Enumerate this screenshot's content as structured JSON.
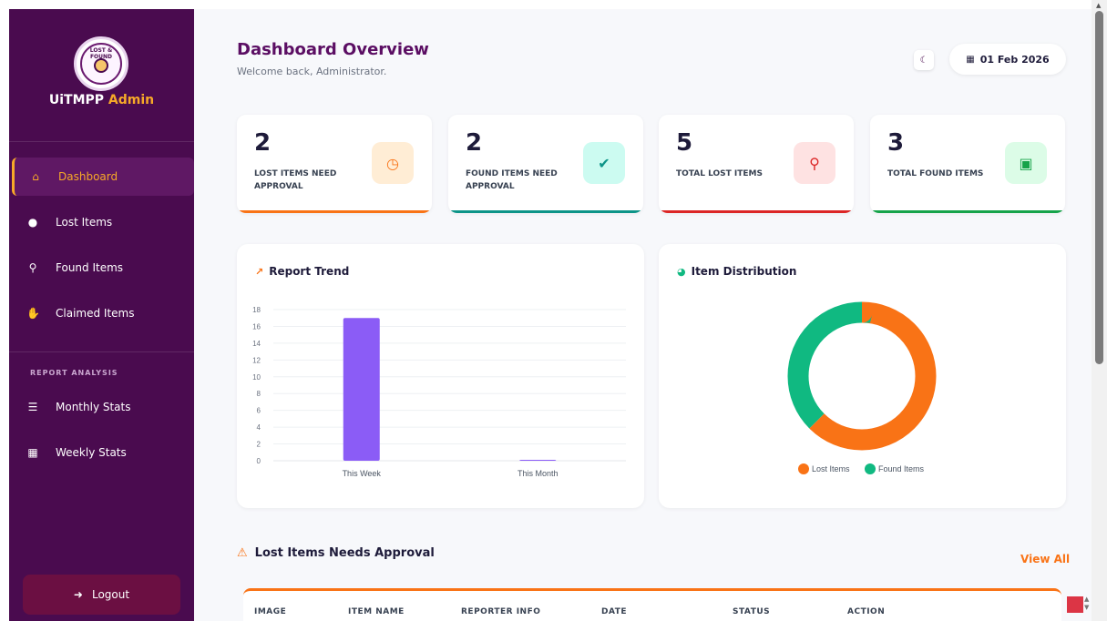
{
  "sidebar": {
    "brand_main": "UiTMPP",
    "brand_accent": "Admin",
    "logo_text": "LOST & FOUND",
    "nav": [
      {
        "label": "Dashboard",
        "icon": "home-icon",
        "active": true
      },
      {
        "label": "Lost Items",
        "icon": "alert-circle-icon"
      },
      {
        "label": "Found Items",
        "icon": "search-plus-icon"
      },
      {
        "label": "Claimed Items",
        "icon": "handshake-icon"
      }
    ],
    "section_label": "REPORT ANALYSIS",
    "reports": [
      {
        "label": "Monthly Stats",
        "icon": "bar-list-icon"
      },
      {
        "label": "Weekly Stats",
        "icon": "calendar-check-icon"
      }
    ],
    "logout_label": "Logout"
  },
  "header": {
    "title": "Dashboard Overview",
    "subtitle": "Welcome back, Administrator.",
    "date": "01 Feb 2026"
  },
  "stats": [
    {
      "value": "2",
      "label": "LOST ITEMS NEED APPROVAL",
      "color": "#f97316",
      "icon": "clock-icon"
    },
    {
      "value": "2",
      "label": "FOUND ITEMS NEED APPROVAL",
      "color": "#0d9488",
      "icon": "clipboard-check-icon"
    },
    {
      "value": "5",
      "label": "TOTAL LOST ITEMS",
      "color": "#dc2626",
      "icon": "search-icon"
    },
    {
      "value": "3",
      "label": "TOTAL FOUND ITEMS",
      "color": "#16a34a",
      "icon": "box-open-icon"
    }
  ],
  "trend_panel": {
    "title": "Report Trend"
  },
  "distribution_panel": {
    "title": "Item Distribution"
  },
  "chart_data": [
    {
      "type": "bar",
      "categories": [
        "This Week",
        "This Month"
      ],
      "values": [
        17,
        0
      ],
      "ylim": [
        0,
        18
      ],
      "yticks": [
        0,
        2,
        4,
        6,
        8,
        10,
        12,
        14,
        16,
        18
      ],
      "color": "#8b5cf6",
      "grid": true
    },
    {
      "type": "pie",
      "labels": [
        "Lost Items",
        "Found Items"
      ],
      "values": [
        5,
        3
      ],
      "colors": [
        "#f97316",
        "#10b981"
      ],
      "donut": true,
      "legend": "bottom"
    }
  ],
  "approval": {
    "title": "Lost Items Needs Approval",
    "view_all": "View All",
    "columns": [
      "IMAGE",
      "ITEM NAME",
      "REPORTER INFO",
      "DATE",
      "STATUS",
      "ACTION"
    ]
  }
}
